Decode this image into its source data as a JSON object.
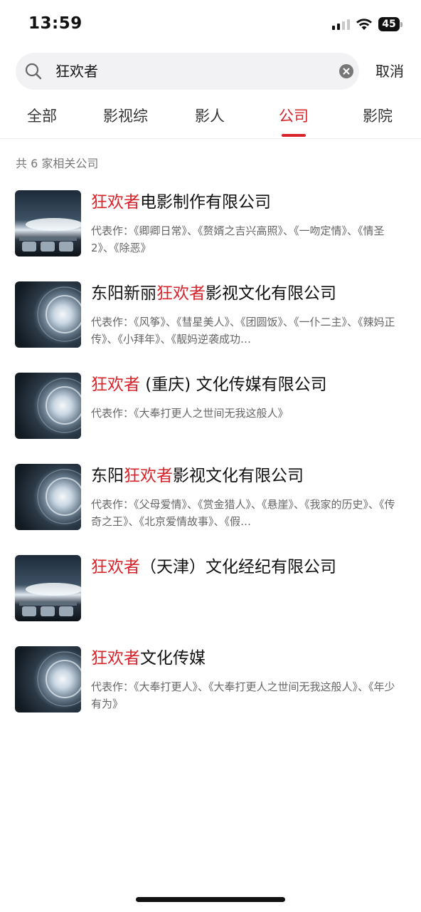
{
  "status": {
    "time": "13:59",
    "battery": "45",
    "icons": [
      "signal-icon",
      "wifi-icon",
      "battery-icon"
    ]
  },
  "search": {
    "query": "狂欢者",
    "cancel_label": "取消",
    "icons": [
      "search-icon",
      "clear-icon"
    ]
  },
  "tabs": [
    {
      "label": "全部",
      "active": false
    },
    {
      "label": "影视综",
      "active": false
    },
    {
      "label": "影人",
      "active": false
    },
    {
      "label": "公司",
      "active": true
    },
    {
      "label": "影院",
      "active": false
    }
  ],
  "result_count": "共 6 家相关公司",
  "colors": {
    "accent": "#d8232a",
    "text": "#111111",
    "secondary_text": "#666666"
  },
  "companies": [
    {
      "name_prefix": "",
      "name_highlight": "狂欢者",
      "name_suffix": "电影制作有限公司",
      "works": "代表作：《卿卿日常》、《赘婿之吉兴高照》、《一吻定情》、《情圣 2》、《除恶》",
      "thumb": "cinema"
    },
    {
      "name_prefix": "东阳新丽",
      "name_highlight": "狂欢者",
      "name_suffix": "影视文化有限公司",
      "works": "代表作：《风筝》、《彗星美人》、《团圆饭》、《一仆二主》、《辣妈正传》、《小拜年》、《靓妈逆袭成功…",
      "thumb": "lens"
    },
    {
      "name_prefix": "",
      "name_highlight": "狂欢者",
      "name_suffix": " (重庆) 文化传媒有限公司",
      "works": "代表作：《大奉打更人之世间无我这般人》",
      "thumb": "lens"
    },
    {
      "name_prefix": "东阳",
      "name_highlight": "狂欢者",
      "name_suffix": "影视文化有限公司",
      "works": "代表作：《父母爱情》、《赏金猎人》、《悬崖》、《我家的历史》、《传奇之王》、《北京爱情故事》、《假…",
      "thumb": "lens"
    },
    {
      "name_prefix": "",
      "name_highlight": "狂欢者",
      "name_suffix": "（天津）文化经纪有限公司",
      "works": "",
      "thumb": "cinema"
    },
    {
      "name_prefix": "",
      "name_highlight": "狂欢者",
      "name_suffix": "文化传媒",
      "works": "代表作：《大奉打更人》、《大奉打更人之世间无我这般人》、《年少有为》",
      "thumb": "lens"
    }
  ]
}
